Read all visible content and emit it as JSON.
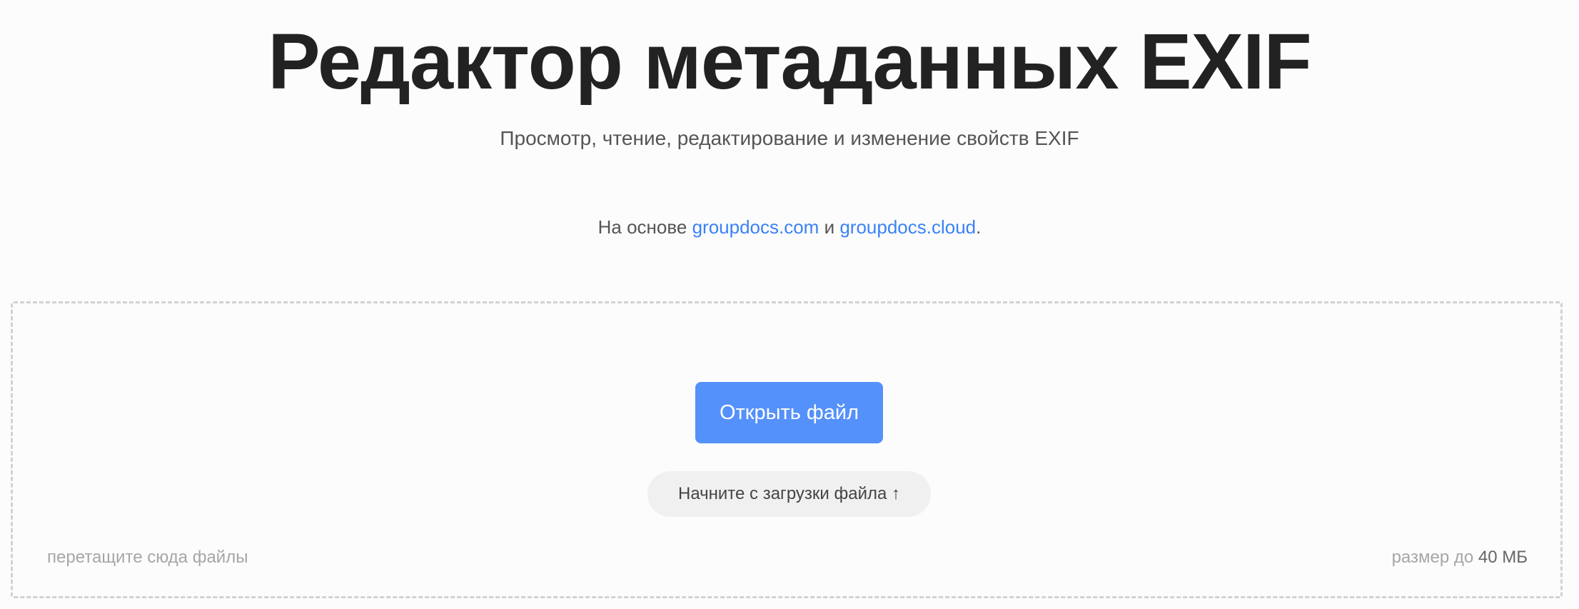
{
  "header": {
    "title": "Редактор метаданных EXIF",
    "subtitle": "Просмотр, чтение, редактирование и изменение свойств EXIF",
    "powered_prefix": "На основе ",
    "powered_link1": "groupdocs.com",
    "powered_conjunction": " и ",
    "powered_link2": "groupdocs.cloud",
    "powered_suffix": "."
  },
  "dropzone": {
    "open_button_label": "Открыть файл",
    "hint_label": "Начните с загрузки файла ↑",
    "drag_hint": "перетащите сюда файлы",
    "size_prefix": "размер до ",
    "size_value": "40 МБ"
  },
  "colors": {
    "accent_button": "#5591fa",
    "link": "#3b82f6",
    "title": "#222222",
    "muted": "#a6a6a6"
  }
}
